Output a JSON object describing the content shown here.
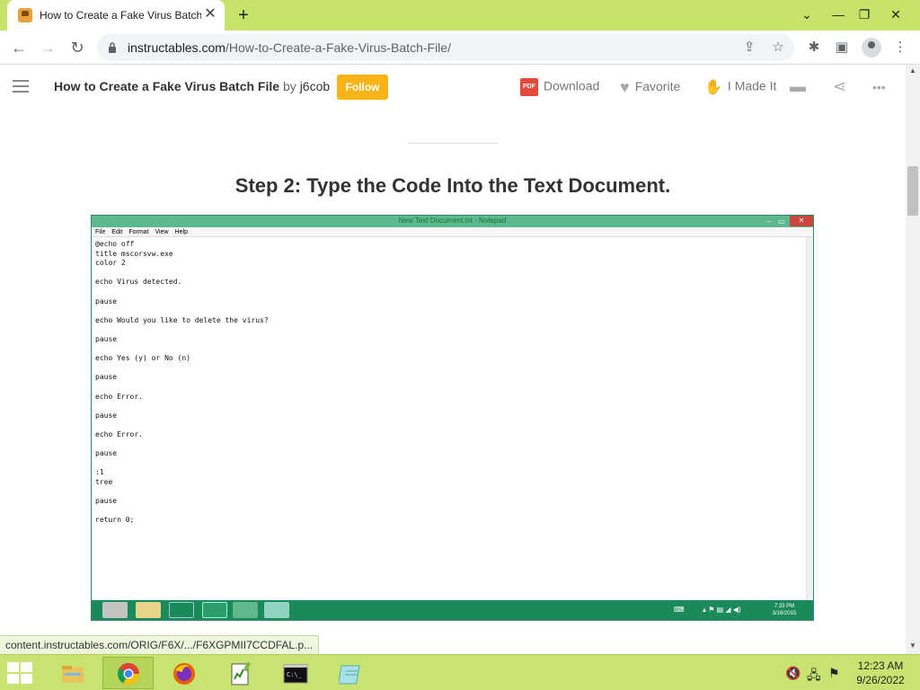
{
  "browser": {
    "tab_title": "How to Create a Fake Virus Batch File",
    "tab_close": "✕",
    "new_tab": "+",
    "url_host": "instructables.com",
    "url_path": "/How-to-Create-a-Fake-Virus-Batch-File/",
    "window_controls": {
      "minimize": "—",
      "restore": "❐",
      "close": "✕"
    },
    "tab_dropdown": "⌄",
    "nav": {
      "back": "←",
      "forward": "→",
      "reload": "↻"
    },
    "icons": {
      "share": "⇪",
      "bookmark": "☆",
      "extensions": "✱",
      "side_panel": "▣",
      "menu": "⋮"
    }
  },
  "site": {
    "title": "How to Create a Fake Virus Batch File",
    "by": "by",
    "author": "j6cob",
    "follow": "Follow",
    "actions": {
      "download": "Download",
      "pdf_badge": "PDF",
      "favorite": "Favorite",
      "i_made_it": "I Made It"
    },
    "icons": {
      "comment": "▬",
      "share": "⋖",
      "more": "•••"
    }
  },
  "content": {
    "step_title": "Step 2: Type the Code Into the Text Document."
  },
  "notepad": {
    "title": "New Text Document.txt - Notepad",
    "controls": {
      "minimize": "–",
      "maximize": "▭",
      "close": "✕"
    },
    "menu": [
      "File",
      "Edit",
      "Format",
      "View",
      "Help"
    ],
    "text": "@echo off\ntitle mscorsvw.exe\ncolor 2\n\necho Virus detected.\n\npause\n\necho Would you like to delete the virus?\n\npause\n\necho Yes (y) or No (n)\n\npause\n\necho Error.\n\npause\n\necho Error.\n\npause\n\n:1\ntree\n\npause\n\nreturn 0;",
    "taskbar_time": "7:33 PM",
    "taskbar_date": "3/16/2015"
  },
  "statusbar": {
    "url": "content.instructables.com/ORIG/F6X/.../F6XGPMII7CCDFAL.p..."
  },
  "scrollbar": {
    "up": "▲",
    "down": "▼"
  },
  "taskbar": {
    "time": "12:23 AM",
    "date": "9/26/2022",
    "apps": [
      "file-explorer",
      "chrome",
      "firefox",
      "notepad-plus-plus",
      "command-prompt",
      "notepad"
    ]
  },
  "colors": {
    "tabbar": "#c7e36a",
    "taskbar": "#c8e36f",
    "follow": "#fab418",
    "notepad_titlebar": "#5cb98f",
    "inner_taskbar": "#1a8a5a"
  }
}
